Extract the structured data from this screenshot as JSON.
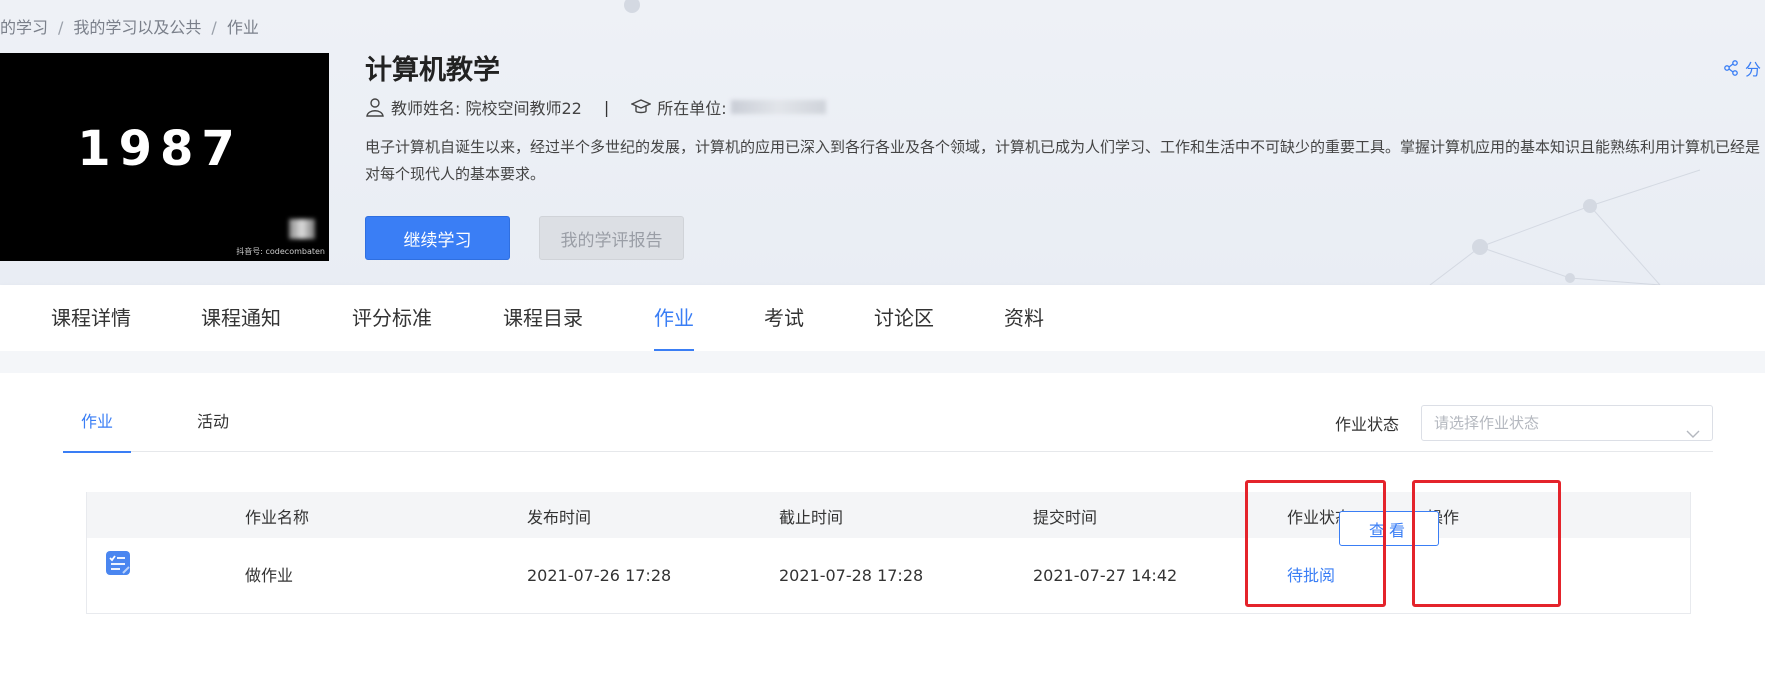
{
  "breadcrumb": {
    "items": [
      "的学习",
      "我的学习以及公共",
      "作业"
    ],
    "separator": "/"
  },
  "cover": {
    "number": "1987",
    "watermark": "抖音号: codecombaten"
  },
  "course": {
    "title": "计算机教学",
    "teacher_label": "教师姓名: 院校空间教师22",
    "unit_label": "所在单位:",
    "unit_value_redacted": true,
    "description": "电子计算机自诞生以来，经过半个多世纪的发展，计算机的应用已深入到各行各业及各个领域，计算机已成为人们学习、工作和生活中不可缺少的重要工具。掌握计算机应用的基本知识且能熟练利用计算机已经是对每个现代人的基本要求。"
  },
  "buttons": {
    "continue": "继续学习",
    "report": "我的学评报告"
  },
  "share": {
    "label": "分"
  },
  "tabs": [
    {
      "label": "课程详情"
    },
    {
      "label": "课程通知"
    },
    {
      "label": "评分标准"
    },
    {
      "label": "课程目录"
    },
    {
      "label": "作业",
      "active": true
    },
    {
      "label": "考试"
    },
    {
      "label": "讨论区"
    },
    {
      "label": "资料"
    }
  ],
  "subtabs": [
    {
      "label": "作业",
      "active": true
    },
    {
      "label": "活动"
    }
  ],
  "filter": {
    "label": "作业状态",
    "placeholder": "请选择作业状态"
  },
  "table": {
    "headers": [
      "作业名称",
      "发布时间",
      "截止时间",
      "提交时间",
      "作业状态",
      "操作"
    ],
    "rows": [
      {
        "name": "做作业",
        "published": "2021-07-26 17:28",
        "deadline": "2021-07-28 17:28",
        "submitted": "2021-07-27 14:42",
        "status": "待批阅",
        "action": "查看"
      }
    ]
  },
  "colors": {
    "accent": "#3a7ef5",
    "highlight": "#e4232b"
  }
}
